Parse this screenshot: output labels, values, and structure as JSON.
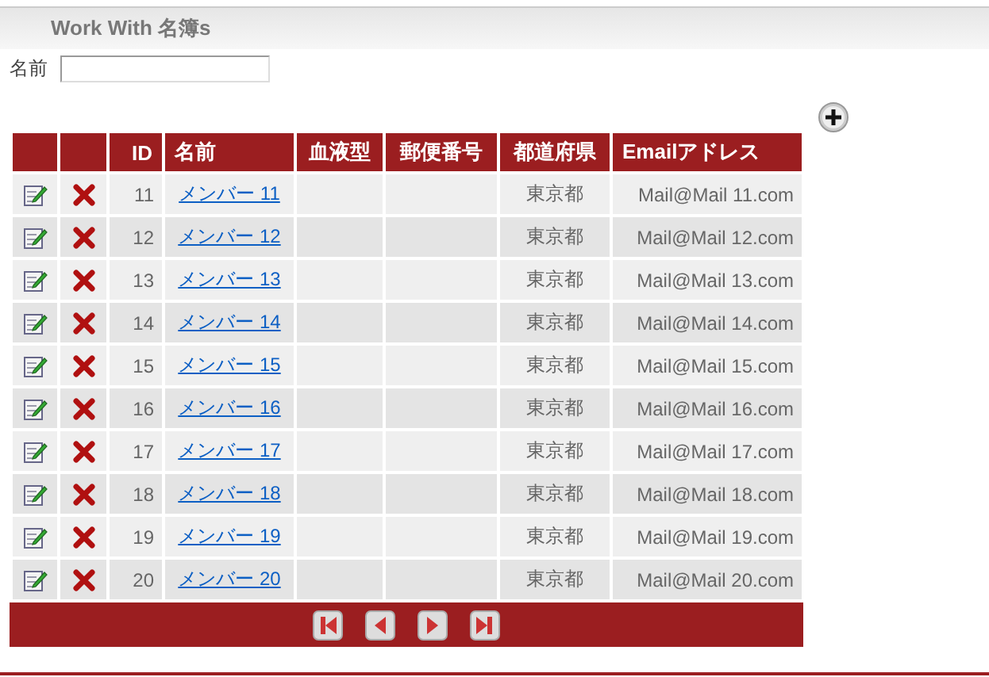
{
  "page_title": "Work With 名簿s",
  "filter": {
    "label": "名前"
  },
  "table": {
    "columns": [
      "",
      "",
      "ID",
      "名前",
      "血液型",
      "郵便番号",
      "都道府県",
      "Emailアドレス"
    ],
    "rows": [
      {
        "id": "11",
        "name": "メンバー 11",
        "prefecture": "東京都",
        "email": "Mail@Mail 11.com"
      },
      {
        "id": "12",
        "name": "メンバー 12",
        "prefecture": "東京都",
        "email": "Mail@Mail 12.com"
      },
      {
        "id": "13",
        "name": "メンバー 13",
        "prefecture": "東京都",
        "email": "Mail@Mail 13.com"
      },
      {
        "id": "14",
        "name": "メンバー 14",
        "prefecture": "東京都",
        "email": "Mail@Mail 14.com"
      },
      {
        "id": "15",
        "name": "メンバー 15",
        "prefecture": "東京都",
        "email": "Mail@Mail 15.com"
      },
      {
        "id": "16",
        "name": "メンバー 16",
        "prefecture": "東京都",
        "email": "Mail@Mail 16.com"
      },
      {
        "id": "17",
        "name": "メンバー 17",
        "prefecture": "東京都",
        "email": "Mail@Mail 17.com"
      },
      {
        "id": "18",
        "name": "メンバー 18",
        "prefecture": "東京都",
        "email": "Mail@Mail 18.com"
      },
      {
        "id": "19",
        "name": "メンバー 19",
        "prefecture": "東京都",
        "email": "Mail@Mail 19.com"
      },
      {
        "id": "20",
        "name": "メンバー 20",
        "prefecture": "東京都",
        "email": "Mail@Mail 20.com"
      }
    ]
  },
  "pager": [
    {
      "kind": "first"
    },
    {
      "kind": "prev"
    },
    {
      "kind": "next"
    },
    {
      "kind": "last"
    }
  ]
}
